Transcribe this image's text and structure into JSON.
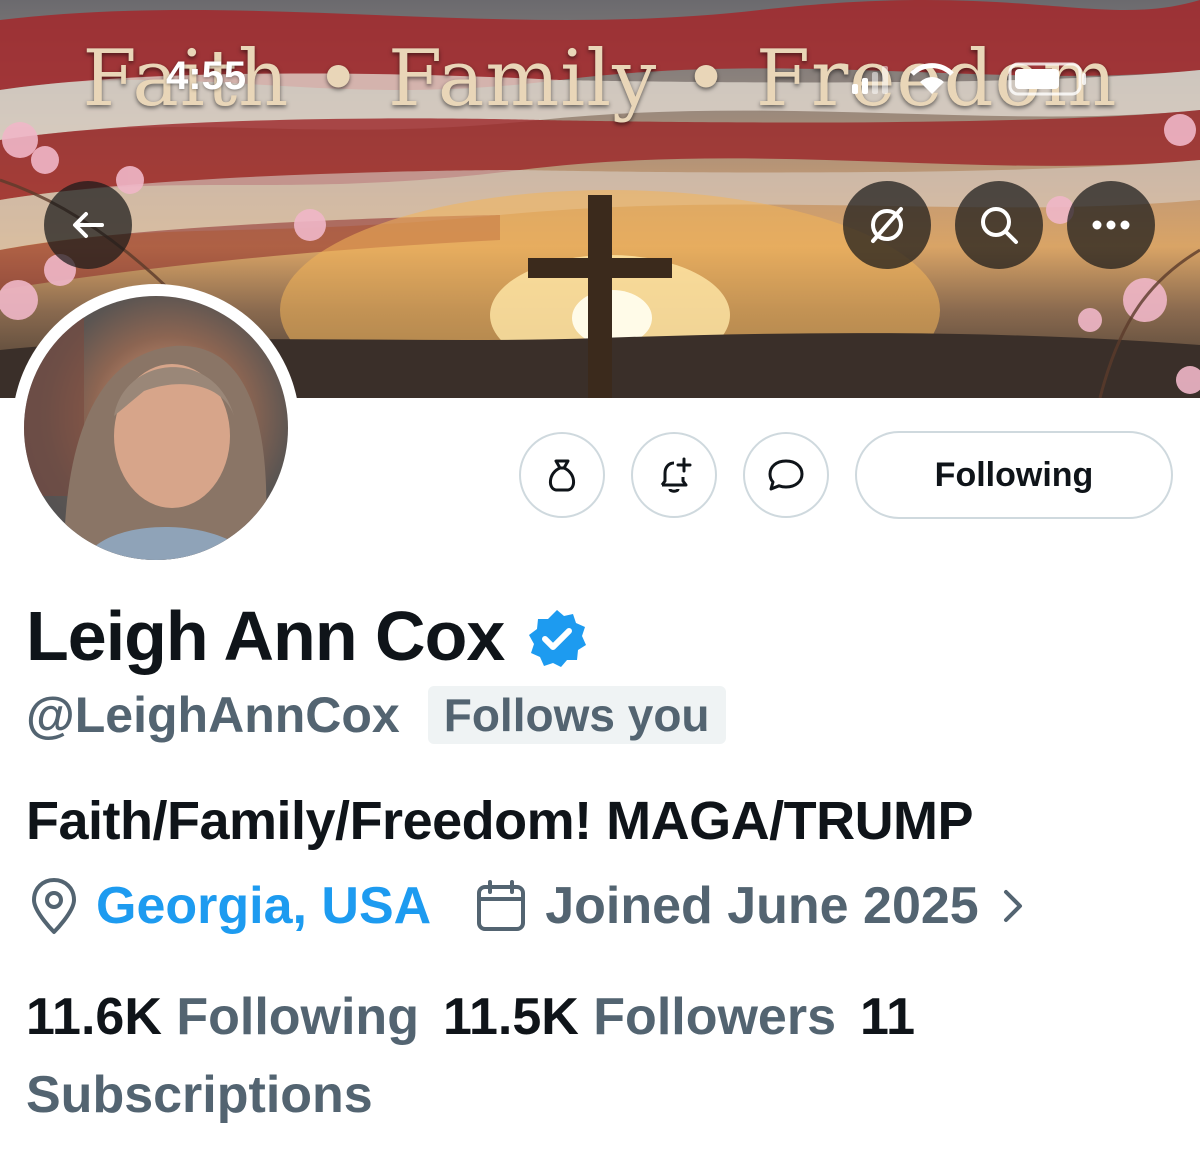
{
  "status_bar": {
    "time": "4:55"
  },
  "banner": {
    "headline": "Faith • Family • Freedom"
  },
  "actions": {
    "following_label": "Following"
  },
  "profile": {
    "display_name": "Leigh Ann Cox",
    "handle": "@LeighAnnCox",
    "follows_you": "Follows you",
    "bio": "Faith/Family/Freedom! MAGA/TRUMP",
    "location": "Georgia, USA",
    "joined": "Joined June 2025"
  },
  "stats": {
    "following_count": "11.6K",
    "following_label": "Following",
    "followers_count": "11.5K",
    "followers_label": "Followers",
    "subscriptions_count": "11",
    "subscriptions_label": "Subscriptions"
  },
  "icons": {
    "back": "back-arrow-icon",
    "grok": "grok-icon",
    "search": "search-icon",
    "more": "more-icon",
    "tip": "money-bag-icon",
    "notify": "bell-plus-icon",
    "message": "message-bubble-icon",
    "verified": "verified-badge-icon",
    "location": "location-pin-icon",
    "calendar": "calendar-icon",
    "chevron": "chevron-right-icon"
  },
  "colors": {
    "accent": "#1d9bf0",
    "secondary_text": "#536471",
    "primary_text": "#0f1419",
    "border": "#cfd9de"
  }
}
